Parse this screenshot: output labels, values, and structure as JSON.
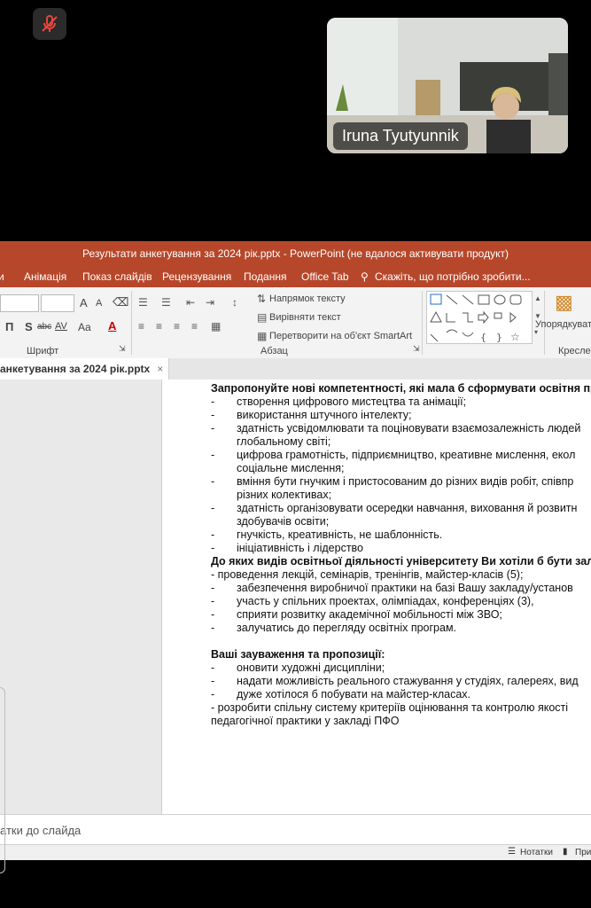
{
  "meeting": {
    "participant_name": "Iruna Tyutyunnik"
  },
  "powerpoint": {
    "window_title": "Результати анкетування за 2024 рік.pptx - PowerPoint (не вдалося активувати продукт)",
    "menu": [
      "и",
      "Анімація",
      "Показ слайдів",
      "Рецензування",
      "Подання",
      "Office Tab"
    ],
    "tell_me": "Скажіть, що потрібно зробити...",
    "ribbon": {
      "text_direction": "Напрямок тексту",
      "align_text": "Вирівняти текст",
      "convert_smartart": "Перетворити на об'єкт SmartArt",
      "group_font": "Шрифт",
      "group_paragraph": "Абзац",
      "group_drawing": "Кресле",
      "arrange": "Упорядкувати",
      "font_size_up": "A",
      "font_size_down": "A",
      "case_btn": "Aa",
      "font_color": "A",
      "underline": "П",
      "shadow": "S",
      "strike": "abc",
      "spacing": "AV"
    },
    "doc_tab": "анкетування за 2024 рік.pptx",
    "notes_placeholder": "атки до слайда",
    "status": {
      "notes": "Нотатки",
      "comments": "При"
    },
    "slide_lines": [
      {
        "dash": "",
        "text": "Запропонуйте нові компетентності, які мала б сформувати освітня пр",
        "bold": true,
        "indent": 0
      },
      {
        "dash": "-",
        "text": "створення цифрового мистецтва та анімації;",
        "bold": false,
        "indent": 1
      },
      {
        "dash": "-",
        "text": "використання штучного інтелекту;",
        "bold": false,
        "indent": 1
      },
      {
        "dash": "-",
        "text": "здатність усвідомлювати та поціновувати взаємозалежність людей",
        "bold": false,
        "indent": 1
      },
      {
        "dash": "",
        "text": "глобальному світі;",
        "bold": false,
        "indent": 1
      },
      {
        "dash": "-",
        "text": "цифрова грамотність, підприємництво, креативне мислення,  екол",
        "bold": false,
        "indent": 1
      },
      {
        "dash": "",
        "text": "соціальне мислення;",
        "bold": false,
        "indent": 1
      },
      {
        "dash": "-",
        "text": "вміння бути гнучким і пристосованим до різних видів робіт, співпр",
        "bold": false,
        "indent": 1
      },
      {
        "dash": "",
        "text": "різних колективах;",
        "bold": false,
        "indent": 1
      },
      {
        "dash": "-",
        "text": "здатність організовувати осередки навчання, виховання й розвитн",
        "bold": false,
        "indent": 1
      },
      {
        "dash": "",
        "text": "здобувачів освіти;",
        "bold": false,
        "indent": 1
      },
      {
        "dash": "-",
        "text": "гнучкість, креативність, не шаблонність.",
        "bold": false,
        "indent": 1
      },
      {
        "dash": "-",
        "text": "ініціативність і лідерство",
        "bold": false,
        "indent": 1
      },
      {
        "dash": "",
        "text": "До яких видів освітньої діяльності університету Ви хотіли б бути залуч",
        "bold": true,
        "indent": 0
      },
      {
        "dash": "",
        "text": "- проведення лекцій, семінарів, тренінгів, майстер-класів (5);",
        "bold": false,
        "indent": 0
      },
      {
        "dash": "-",
        "text": "забезпечення виробничої практики на базі Вашу закладу/установ",
        "bold": false,
        "indent": 1
      },
      {
        "dash": "-",
        "text": "участь у спільних проектах, олімпіадах, конференціях (3),",
        "bold": false,
        "indent": 1
      },
      {
        "dash": "-",
        "text": "сприяти розвитку академічної мобільності між ЗВО;",
        "bold": false,
        "indent": 1
      },
      {
        "dash": "-",
        "text": "залучатись до перегляду освітніх програм.",
        "bold": false,
        "indent": 1
      },
      {
        "dash": "",
        "text": "",
        "bold": false,
        "indent": 0
      },
      {
        "dash": "",
        "text": "Ваші зауваження та пропозиції:",
        "bold": true,
        "indent": 0
      },
      {
        "dash": "-",
        "text": "оновити художні дисципліни;",
        "bold": false,
        "indent": 1
      },
      {
        "dash": "-",
        "text": "надати можливість реального стажування у студіях, галереях, вид",
        "bold": false,
        "indent": 1
      },
      {
        "dash": "-",
        "text": "дуже хотілося б побувати на майстер-класах.",
        "bold": false,
        "indent": 1
      },
      {
        "dash": "",
        "text": "- розробити спільну систему критеріїв оцінювання та контролю якості",
        "bold": false,
        "indent": 0
      },
      {
        "dash": "",
        "text": "педагогічної практики у закладі ПФО",
        "bold": false,
        "indent": 0
      }
    ]
  }
}
